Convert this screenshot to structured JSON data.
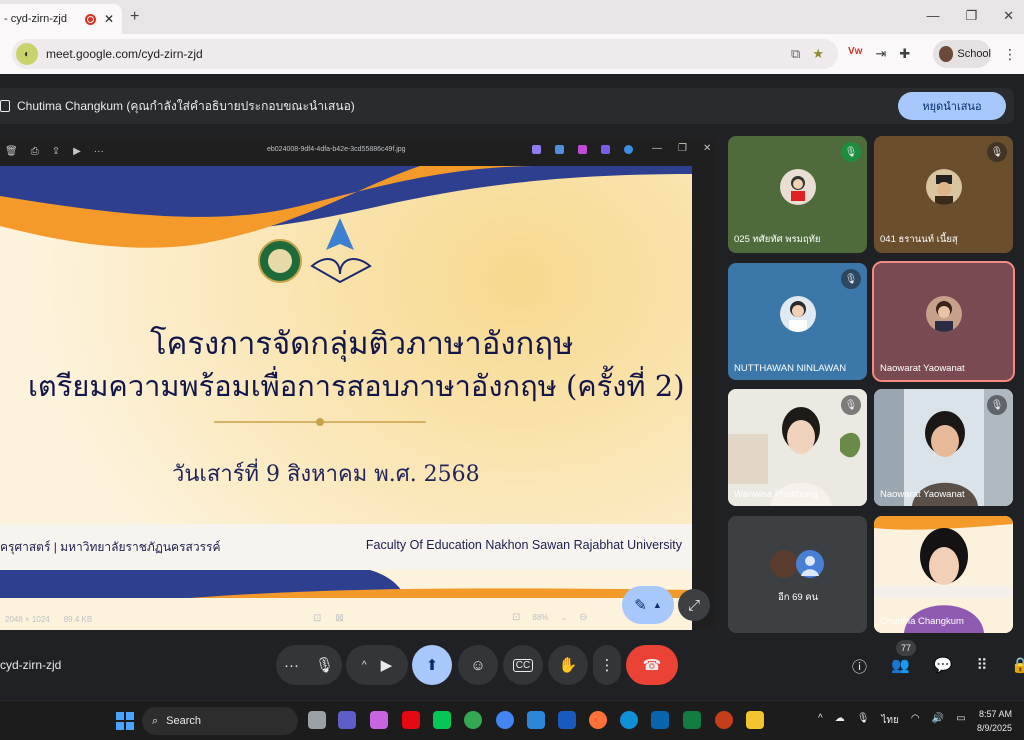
{
  "browser": {
    "tab_title": "- cyd-zirn-zjd",
    "new_tab": "+",
    "url": "meet.google.com/cyd-zirn-zjd",
    "profile_label": "School"
  },
  "meet": {
    "presenting_text": "Chutima Changkum (คุณกำลังใส่คำอธิบายประกอบขณะนำเสนอ)",
    "stop_presenting_label": "หยุดนำเสนอ",
    "meeting_code": "cyd-zirn-zjd",
    "participant_count": "77"
  },
  "viewer": {
    "file_name": "eb024008-9df4-4dfa-b42e-3cd55886c49f.jpg",
    "dimensions": "2048 × 1024",
    "file_size": "89.4 KB",
    "zoom": "88%"
  },
  "slide": {
    "title_line1": "โครงการจัดกลุ่มติวภาษาอังกฤษ",
    "title_line2": "เตรียมความพร้อมเพื่อการสอบภาษาอังกฤษ (ครั้งที่ 2)",
    "date": "วันเสาร์ที่ 9 สิงหาคม พ.ศ. 2568",
    "footer_thai": "ครุศาสตร์ | มหาวิทยาลัยราชภัฏนครสวรรค์",
    "footer_eng": "Faculty Of Education Nakhon Sawan Rajabhat University"
  },
  "participants": [
    {
      "name": "025 ทศัยทัศ พรมฤทัย",
      "muted": true,
      "speaking": true
    },
    {
      "name": "041 ธรานนท์ เนี้ยสุ",
      "muted": true,
      "speaking": false
    },
    {
      "name": "NUTTHAWAN NINLAWAN",
      "muted": true,
      "speaking": false
    },
    {
      "name": "Naowarat Yaowanat",
      "muted": false,
      "speaking": false
    },
    {
      "name": "Wanwisa Phulthong",
      "muted": true,
      "speaking": false
    },
    {
      "name": "Naowarat Yaowanat",
      "muted": true,
      "speaking": false
    },
    {
      "name": "อีก 69 คน",
      "muted": false,
      "speaking": false
    },
    {
      "name": "Chutima Changkum",
      "muted": false,
      "speaking": false
    }
  ],
  "taskbar": {
    "search_label": "Search",
    "language": "ไทย",
    "time": "8:57 AM",
    "date": "8/9/2025"
  },
  "colors": {
    "accent": "#a8c7fa",
    "end_call": "#ea4335",
    "slide_navy": "#13164a",
    "slide_orange": "#f39a2b"
  }
}
